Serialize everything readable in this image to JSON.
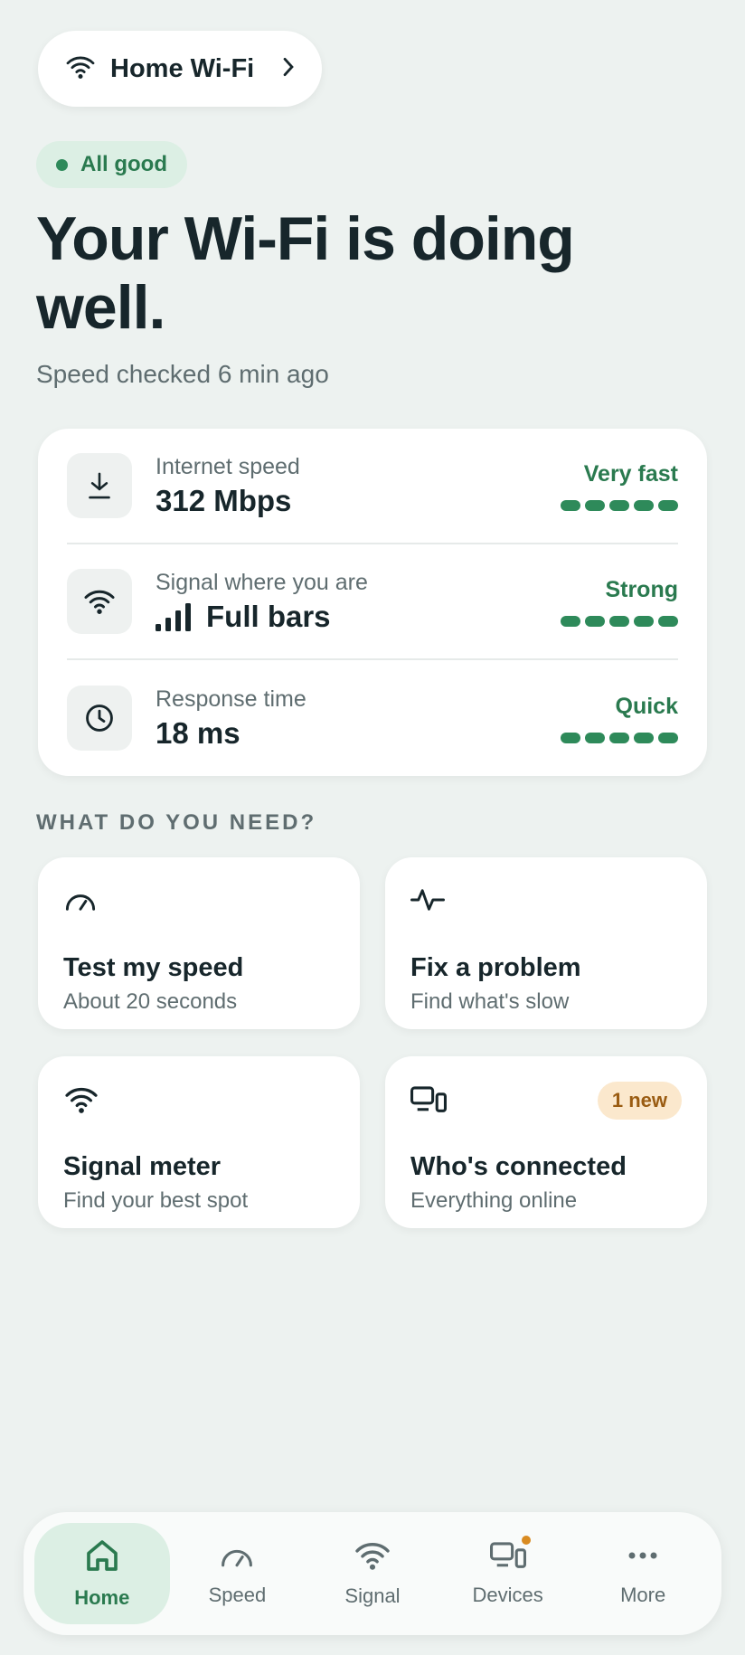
{
  "network": {
    "name": "Home Wi-Fi"
  },
  "status": {
    "label": "All good",
    "headline": "Your Wi-Fi is doing well.",
    "checked": "Speed checked 6 min ago"
  },
  "metrics": [
    {
      "label": "Internet speed",
      "value": "312 Mbps",
      "rating": "Very fast",
      "level": 5,
      "icon": "download-icon"
    },
    {
      "label": "Signal where you are",
      "value": "Full bars",
      "rating": "Strong",
      "level": 5,
      "icon": "wifi-icon"
    },
    {
      "label": "Response time",
      "value": "18 ms",
      "rating": "Quick",
      "level": 5,
      "icon": "clock-icon"
    }
  ],
  "actions_heading": "WHAT DO YOU NEED?",
  "actions": [
    {
      "title": "Test my speed",
      "desc": "About 20 seconds",
      "icon": "speedometer-icon"
    },
    {
      "title": "Fix a problem",
      "desc": "Find what's slow",
      "icon": "pulse-icon"
    },
    {
      "title": "Signal meter",
      "desc": "Find your best spot",
      "icon": "wifi-icon"
    },
    {
      "title": "Who's connected",
      "desc": "Everything online",
      "icon": "devices-icon",
      "badge": "1 new"
    }
  ],
  "nav": [
    {
      "label": "Home",
      "icon": "home-icon",
      "active": true
    },
    {
      "label": "Speed",
      "icon": "speedometer-icon"
    },
    {
      "label": "Signal",
      "icon": "wifi-icon"
    },
    {
      "label": "Devices",
      "icon": "devices-icon",
      "notification": true
    },
    {
      "label": "More",
      "icon": "more-icon"
    }
  ],
  "colors": {
    "accent": "#2e8a5a",
    "background": "#edf2f0",
    "badge": "#fbe8cd"
  }
}
